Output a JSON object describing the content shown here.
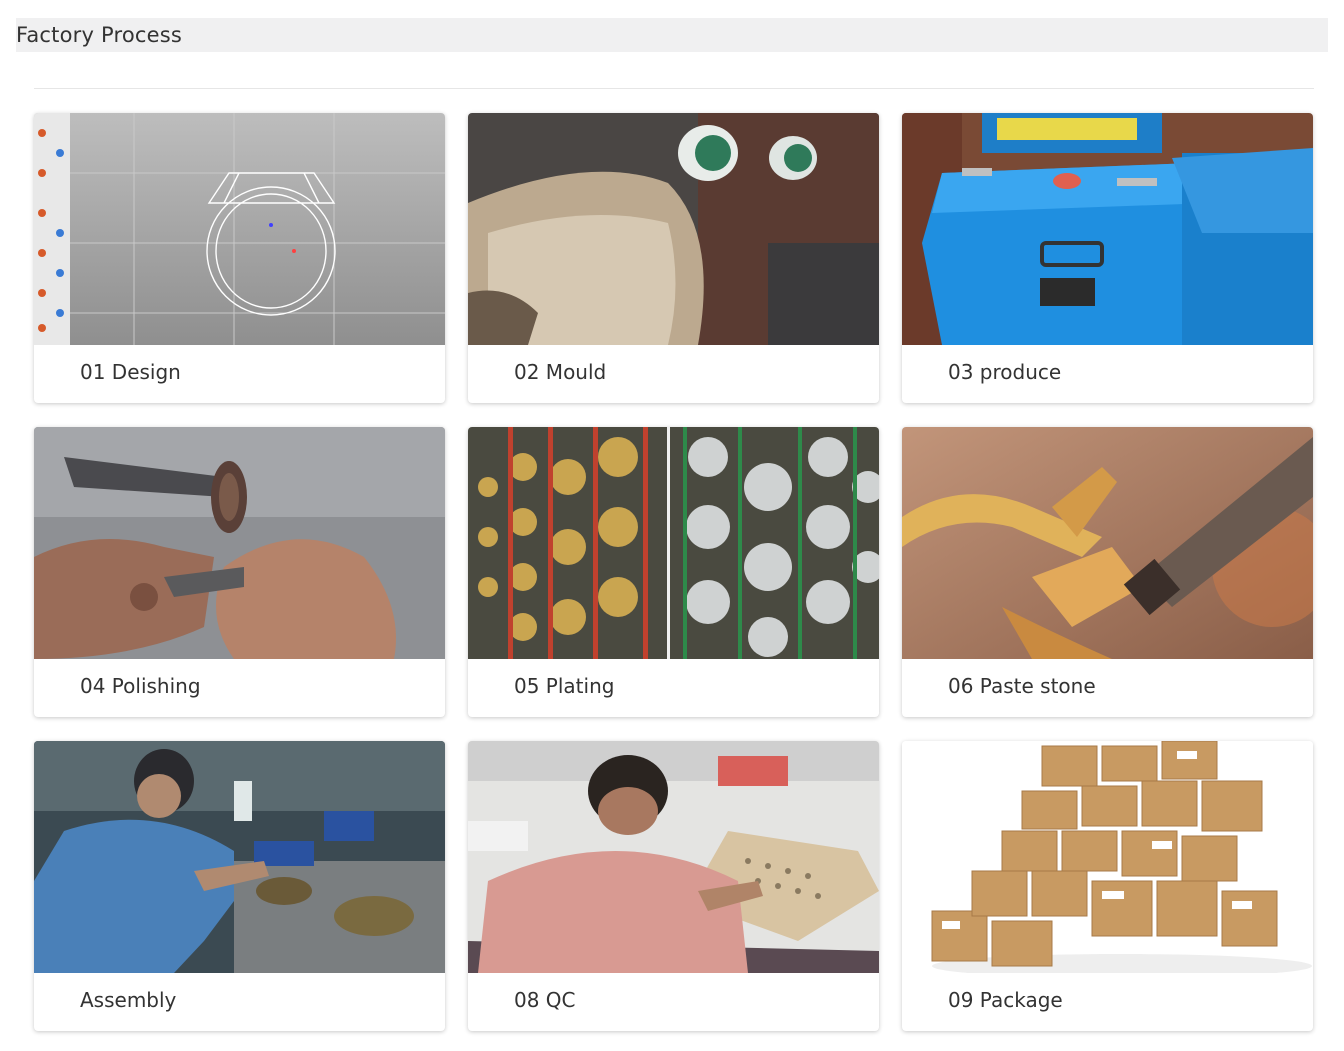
{
  "section": {
    "title": "Factory Process"
  },
  "steps": [
    {
      "label": "01 Design",
      "photo": "cad-ring-design-photo"
    },
    {
      "label": "02 Mould",
      "photo": "mould-press-photo"
    },
    {
      "label": "03 produce",
      "photo": "blue-casting-machine-photo"
    },
    {
      "label": "04 Polishing",
      "photo": "hand-polishing-photo"
    },
    {
      "label": "05 Plating",
      "photo": "plating-racks-photo"
    },
    {
      "label": "06 Paste stone",
      "photo": "stone-setting-photo"
    },
    {
      "label": "Assembly",
      "photo": "assembly-worker-photo"
    },
    {
      "label": "08 QC",
      "photo": "quality-check-photo"
    },
    {
      "label": "09 Package",
      "photo": "cardboard-boxes-photo"
    }
  ]
}
